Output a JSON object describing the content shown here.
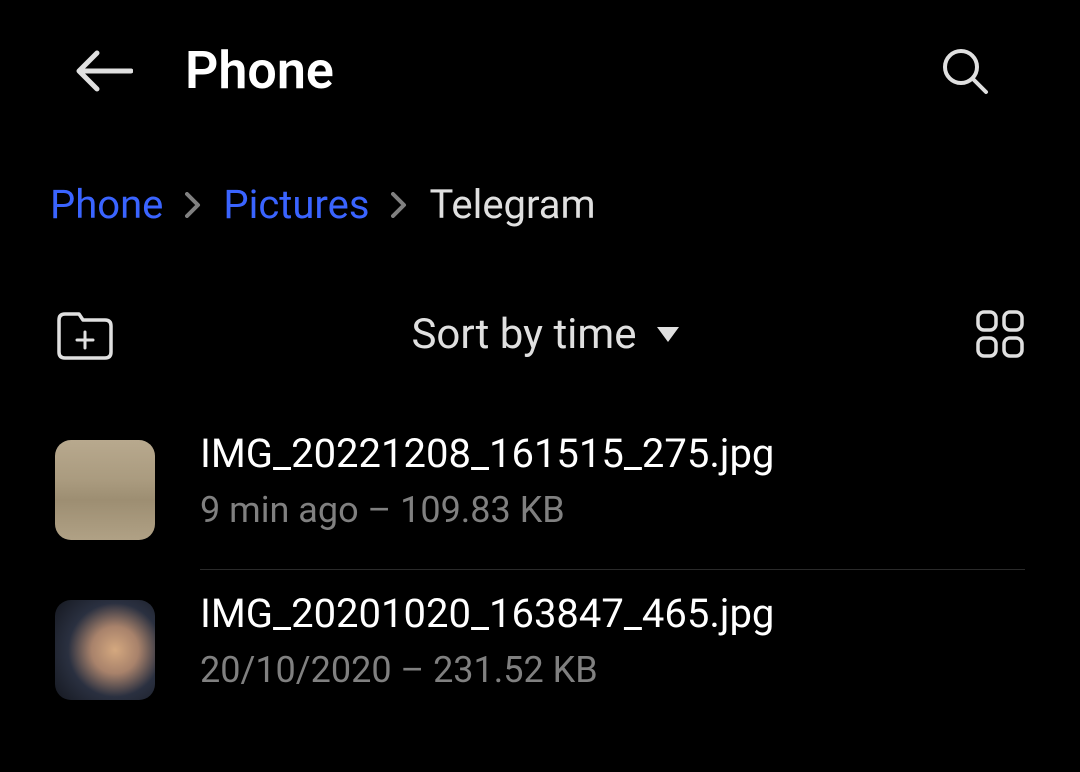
{
  "header": {
    "title": "Phone"
  },
  "breadcrumb": {
    "items": [
      {
        "label": "Phone",
        "link": true
      },
      {
        "label": "Pictures",
        "link": true
      },
      {
        "label": "Telegram",
        "link": false
      }
    ]
  },
  "toolbar": {
    "sort_label": "Sort by time"
  },
  "files": [
    {
      "name": "IMG_20221208_161515_275.jpg",
      "time": "9 min ago",
      "size": "109.83 KB"
    },
    {
      "name": "IMG_20201020_163847_465.jpg",
      "time": "20/10/2020",
      "size": "231.52 KB"
    }
  ]
}
